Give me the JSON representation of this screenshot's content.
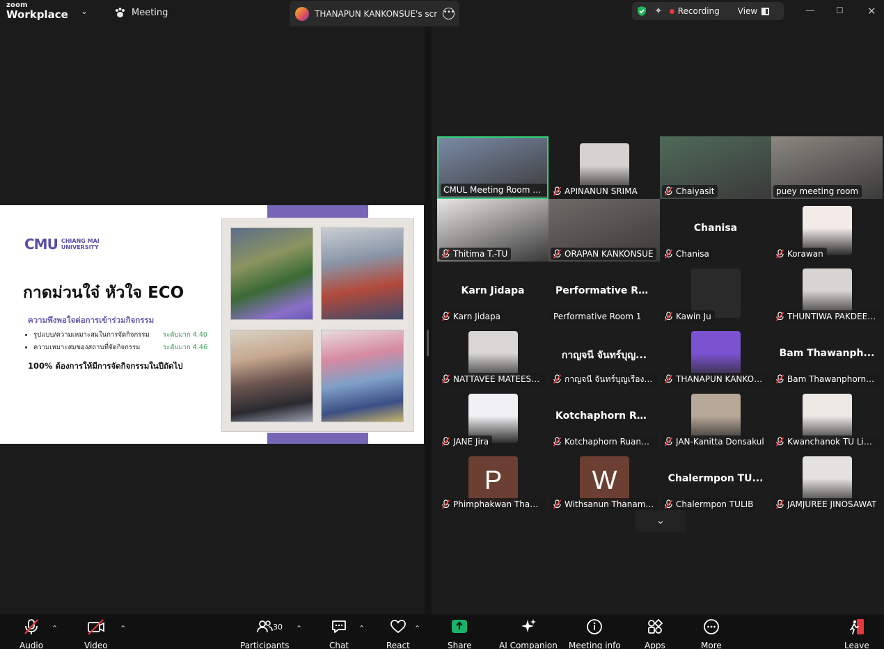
{
  "app": {
    "brand_top": "zoom",
    "brand_bottom": "Workplace",
    "meeting_label": "Meeting",
    "share_tab_title": "THANAPUN KANKONSUE's screen",
    "recording_label": "Recording",
    "view_label": "View"
  },
  "slide": {
    "logo_mark": "CMU",
    "logo_line1": "CHIANG MAI",
    "logo_line2": "UNIVERSITY",
    "title": "กาดม่วนใจ๋ หัวใจ ECO",
    "subtitle": "ความพึงพอใจต่อการเข้าร่วมกิจกรรม",
    "items": [
      {
        "text": "รูปแบบ/ความเหมาะสมในการจัดกิจกรรม",
        "level": "ระดับมาก 4.40"
      },
      {
        "text": "ความเหมาะสมของสถานที่จัดกิจกรรม",
        "level": "ระดับมาก 4.46"
      }
    ],
    "note": "100% ต้องการให้มีการจัดกิจกรรมในปีถัดไป"
  },
  "participants": [
    {
      "name": "CMUL Meeting Room 3...",
      "kind": "video",
      "muted": false,
      "active": true,
      "tone": "#7a8aa5"
    },
    {
      "name": "APINANUN SRIMA",
      "kind": "photo",
      "muted": true,
      "tone": "#d6d2cf"
    },
    {
      "name": "Chaiyasit",
      "kind": "video",
      "muted": true,
      "tone": "#4f6a58"
    },
    {
      "name": "puey meeting room",
      "kind": "video",
      "muted": false,
      "tone": "#8c8880"
    },
    {
      "name": "Thitima T.-TU",
      "kind": "video",
      "muted": true,
      "tone": "#e8e6e4"
    },
    {
      "name": "ORAPAN KANKONSUE",
      "kind": "video",
      "muted": true,
      "tone": "#6f6a66"
    },
    {
      "name": "Chanisa",
      "kind": "name",
      "big": "Chanisa",
      "muted": true
    },
    {
      "name": "Korawan",
      "kind": "photo",
      "muted": true,
      "tone": "#f2ebe8"
    },
    {
      "name": "Karn Jidapa",
      "kind": "name",
      "big": "Karn Jidapa",
      "muted": true
    },
    {
      "name": "Performative Room 1",
      "kind": "name",
      "big": "Performative Ro...",
      "muted": false
    },
    {
      "name": "Kawin Ju",
      "kind": "photo",
      "muted": true,
      "tone": "#2a2a2a"
    },
    {
      "name": "THUNTIWA PAKDEEP...",
      "kind": "photo",
      "muted": true,
      "tone": "#d8d4d2"
    },
    {
      "name": "NATTAVEE MATEESU...",
      "kind": "photo",
      "muted": true,
      "tone": "#d9d7d5"
    },
    {
      "name": "กาญจนี จันทร์บุญเรือง (ส...",
      "kind": "name",
      "big": "กาญจนี จันทร์บุญ...",
      "muted": true
    },
    {
      "name": "THANAPUN KANKON...",
      "kind": "photo",
      "muted": true,
      "tone": "#7b52d0"
    },
    {
      "name": "Bam Thawanphorn_TU",
      "kind": "name",
      "big": "Bam Thawanph...",
      "muted": true
    },
    {
      "name": "JANE Jira",
      "kind": "photo",
      "muted": true,
      "tone": "#f1f1f3"
    },
    {
      "name": "Kotchaphorn Ruanpe...",
      "kind": "name",
      "big": "Kotchaphorn Ru...",
      "muted": true
    },
    {
      "name": "JAN-Kanitta Donsakul",
      "kind": "photo",
      "muted": true,
      "tone": "#b7a796"
    },
    {
      "name": "Kwanchanok TU Libra...",
      "kind": "photo",
      "muted": true,
      "tone": "#efe9e6"
    },
    {
      "name": "Phimphakwan Thanan...",
      "kind": "letter",
      "letter": "P",
      "muted": true
    },
    {
      "name": "Withsanun Thanamap...",
      "kind": "letter",
      "letter": "W",
      "muted": true
    },
    {
      "name": "Chalermpon TULIB",
      "kind": "name",
      "big": "Chalermpon TU...",
      "muted": true
    },
    {
      "name": "JAMJUREE JINOSAWAT",
      "kind": "photo",
      "muted": true,
      "tone": "#e4e2e0"
    }
  ],
  "toolbar": {
    "audio": "Audio",
    "video": "Video",
    "participants": "Participants",
    "participants_count": "30",
    "chat": "Chat",
    "react": "React",
    "share": "Share",
    "ai_companion": "AI Companion",
    "meeting_info": "Meeting info",
    "apps": "Apps",
    "more": "More",
    "leave": "Leave"
  },
  "colors": {
    "accent_green": "#32d47a",
    "slide_purple": "#7667b6",
    "share_green": "#19b46b",
    "leave_red": "#e8373c",
    "recording_red": "#e43b3b"
  }
}
